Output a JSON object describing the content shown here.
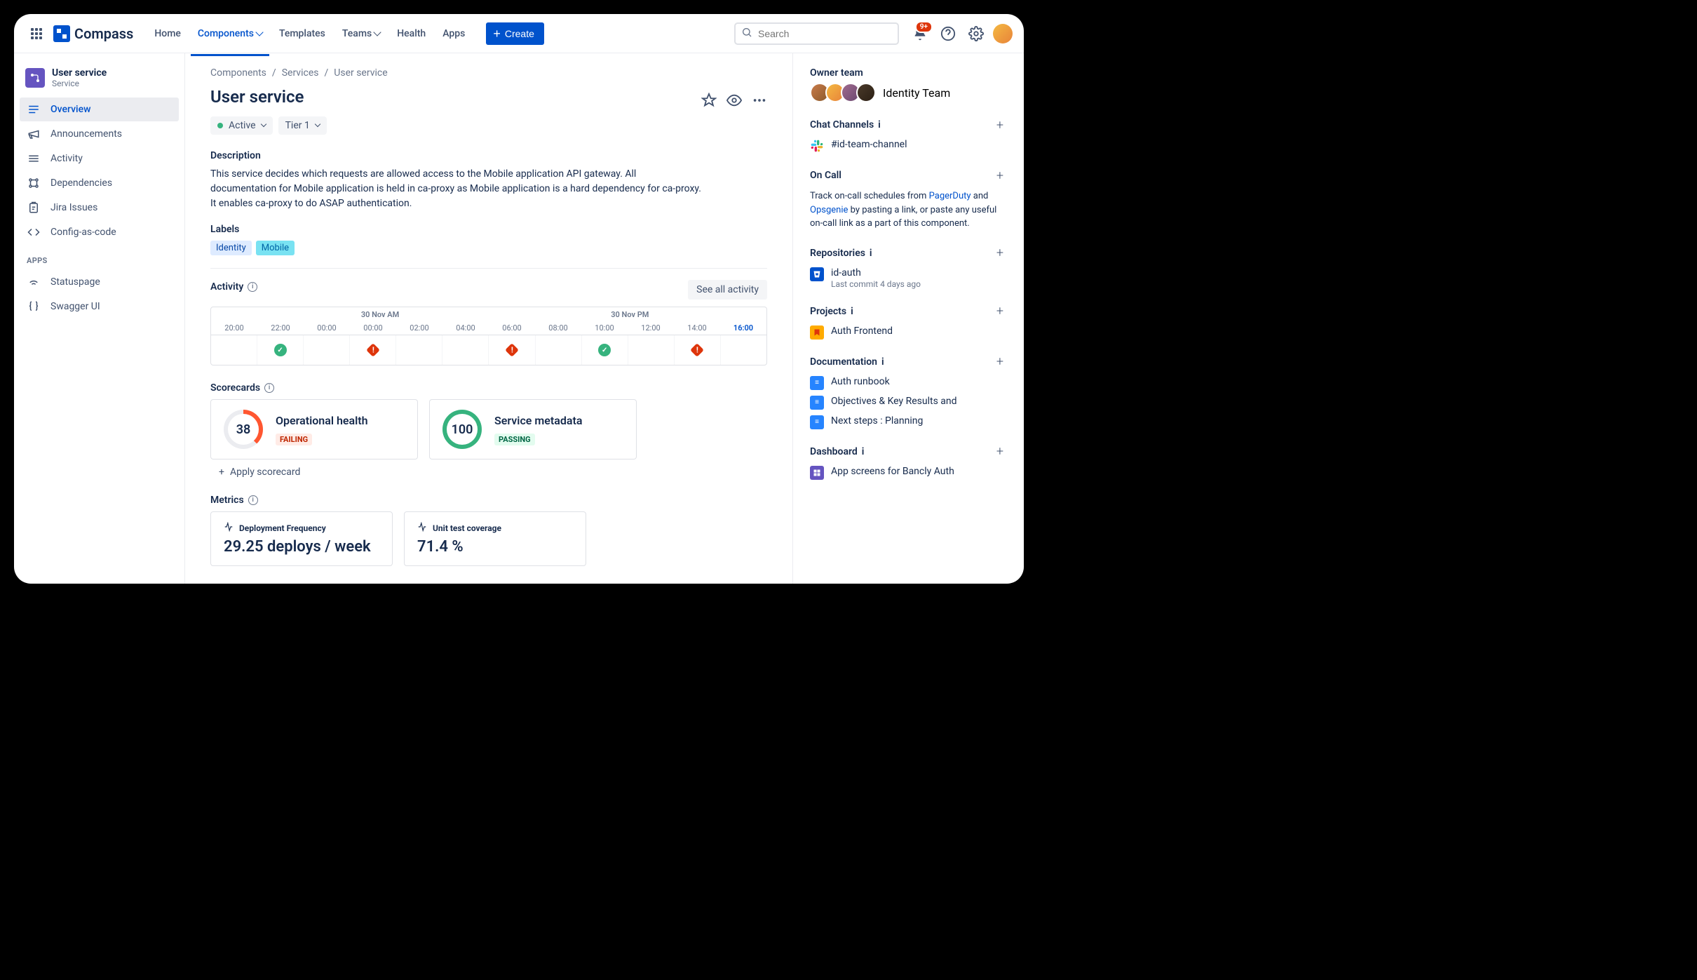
{
  "topnav": {
    "logo_text": "Compass",
    "items": [
      "Home",
      "Components",
      "Templates",
      "Teams",
      "Health",
      "Apps"
    ],
    "active_index": 1,
    "dropdown_indices": [
      1,
      3
    ],
    "create_label": "Create",
    "search_placeholder": "Search",
    "notification_badge": "9+"
  },
  "sidebar": {
    "title": "User service",
    "subtitle": "Service",
    "items": [
      {
        "label": "Overview",
        "icon": "list"
      },
      {
        "label": "Announcements",
        "icon": "megaphone"
      },
      {
        "label": "Activity",
        "icon": "stack"
      },
      {
        "label": "Dependencies",
        "icon": "nodes"
      },
      {
        "label": "Jira Issues",
        "icon": "clipboard"
      },
      {
        "label": "Config-as-code",
        "icon": "code"
      }
    ],
    "active_index": 0,
    "apps_label": "APPS",
    "apps": [
      {
        "label": "Statuspage",
        "icon": "wifi"
      },
      {
        "label": "Swagger UI",
        "icon": "braces"
      }
    ]
  },
  "breadcrumb": [
    "Components",
    "Services",
    "User service"
  ],
  "page": {
    "title": "User service",
    "status": "Active",
    "tier": "Tier 1",
    "description_label": "Description",
    "description": "This service decides which requests are allowed access to the Mobile application API gateway. All documentation for Mobile application is held in ca-proxy as Mobile application is a hard dependency for ca-proxy. It enables ca-proxy to do ASAP authentication.",
    "labels_label": "Labels",
    "labels": [
      {
        "text": "Identity",
        "class": "label-identity"
      },
      {
        "text": "Mobile",
        "class": "label-mobile"
      }
    ]
  },
  "activity": {
    "label": "Activity",
    "see_all": "See all activity",
    "day_am": "30 Nov AM",
    "day_pm": "30 Nov PM",
    "times": [
      "20:00",
      "22:00",
      "00:00",
      "00:00",
      "02:00",
      "04:00",
      "06:00",
      "08:00",
      "10:00",
      "12:00",
      "14:00",
      "16:00"
    ],
    "current_time_index": 11,
    "events": [
      "",
      "ok",
      "",
      "err",
      "",
      "",
      "err",
      "",
      "ok",
      "",
      "err",
      ""
    ]
  },
  "scorecards": {
    "label": "Scorecards",
    "cards": [
      {
        "score": "38",
        "title": "Operational health",
        "status": "FAILING",
        "ring": "ring-fail",
        "badge": "fail"
      },
      {
        "score": "100",
        "title": "Service metadata",
        "status": "PASSING",
        "ring": "ring-pass",
        "badge": "pass"
      }
    ],
    "apply": "Apply scorecard"
  },
  "metrics": {
    "label": "Metrics",
    "cards": [
      {
        "title": "Deployment Frequency",
        "value": "29.25 deploys / week"
      },
      {
        "title": "Unit test coverage",
        "value": "71.4 %"
      }
    ]
  },
  "rightpanel": {
    "owner": {
      "label": "Owner team",
      "team": "Identity Team"
    },
    "chat": {
      "label": "Chat Channels",
      "channel": "#id-team-channel"
    },
    "oncall": {
      "label": "On Call",
      "text_pre": "Track on-call schedules from ",
      "link1": "PagerDuty",
      "text_mid": " and ",
      "link2": "Opsgenie",
      "text_post": " by pasting a link, or paste any useful on-call link as a part of this component."
    },
    "repos": {
      "label": "Repositories",
      "name": "id-auth",
      "sub": "Last commit 4 days ago"
    },
    "projects": {
      "label": "Projects",
      "name": "Auth Frontend"
    },
    "docs": {
      "label": "Documentation",
      "items": [
        "Auth runbook",
        "Objectives & Key Results and",
        "Next steps : Planning"
      ]
    },
    "dashboard": {
      "label": "Dashboard",
      "item": "App screens for Bancly Auth"
    }
  }
}
